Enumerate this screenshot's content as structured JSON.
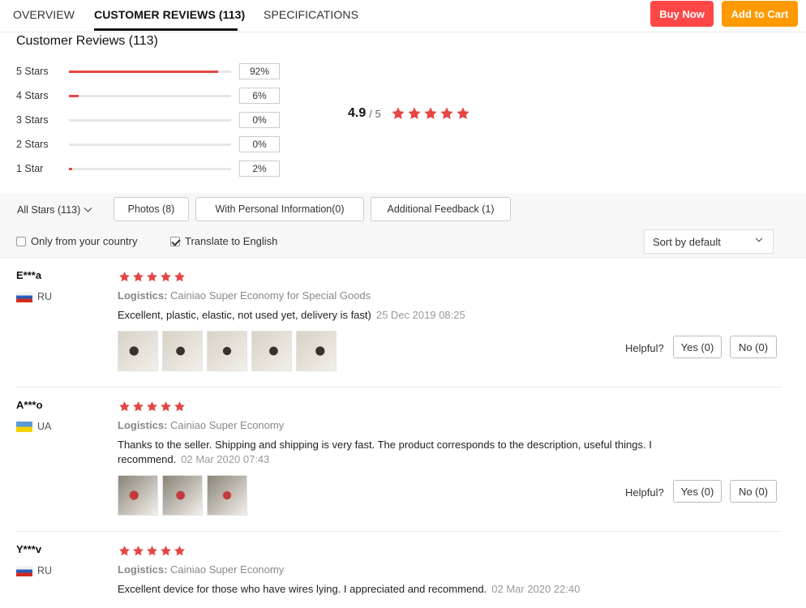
{
  "tabs": [
    {
      "label": "OVERVIEW"
    },
    {
      "label": "CUSTOMER REVIEWS (113)"
    },
    {
      "label": "SPECIFICATIONS"
    }
  ],
  "actions": {
    "buy_now": "Buy Now",
    "add_to_cart": "Add to Cart"
  },
  "colors": {
    "buy_now": "#ff4747",
    "add_to_cart": "#ff9a00",
    "star": "#e64545"
  },
  "reviews_summary": {
    "title": "Customer Reviews (113)",
    "histogram": [
      {
        "label": "5 Stars",
        "percent": "92%",
        "fraction": 0.92
      },
      {
        "label": "4 Stars",
        "percent": "6%",
        "fraction": 0.06
      },
      {
        "label": "3 Stars",
        "percent": "0%",
        "fraction": 0.0
      },
      {
        "label": "2 Stars",
        "percent": "0%",
        "fraction": 0.0
      },
      {
        "label": "1 Star",
        "percent": "2%",
        "fraction": 0.02
      }
    ],
    "average": "4.9",
    "out_of": "/ 5",
    "average_stars": 5
  },
  "filters": {
    "star_filter": "All Stars (113)",
    "buttons": [
      {
        "label": "Photos (8)"
      },
      {
        "label": "With Personal Information(0)"
      },
      {
        "label": "Additional Feedback (1)"
      }
    ],
    "only_country": {
      "label": "Only from your country",
      "checked": false
    },
    "translate": {
      "label": "Translate to English",
      "checked": true
    },
    "sort": "Sort by default"
  },
  "reviews": [
    {
      "name": "E***a",
      "country": "RU",
      "stars": 5,
      "logistics_label": "Logistics:",
      "logistics": "Cainiao Super Economy for Special Goods",
      "text": "Excellent, plastic, elastic, not used yet, delivery is fast)",
      "date": "25 Dec 2019 08:25",
      "photo_count": 5,
      "helpful": "Helpful?",
      "yes": "Yes (0)",
      "no": "No (0)"
    },
    {
      "name": "A***o",
      "country": "UA",
      "stars": 5,
      "logistics_label": "Logistics:",
      "logistics": "Cainiao Super Economy",
      "text": "Thanks to the seller. Shipping and shipping is very fast. The product corresponds to the description, useful things. I recommend.",
      "date": "02 Mar 2020 07:43",
      "photo_count": 3,
      "helpful": "Helpful?",
      "yes": "Yes (0)",
      "no": "No (0)"
    },
    {
      "name": "Y***v",
      "country": "RU",
      "stars": 5,
      "logistics_label": "Logistics:",
      "logistics": "Cainiao Super Economy",
      "text": "Excellent device for those who have wires lying. I appreciated and recommend.",
      "date": "02 Mar 2020 22:40"
    }
  ]
}
